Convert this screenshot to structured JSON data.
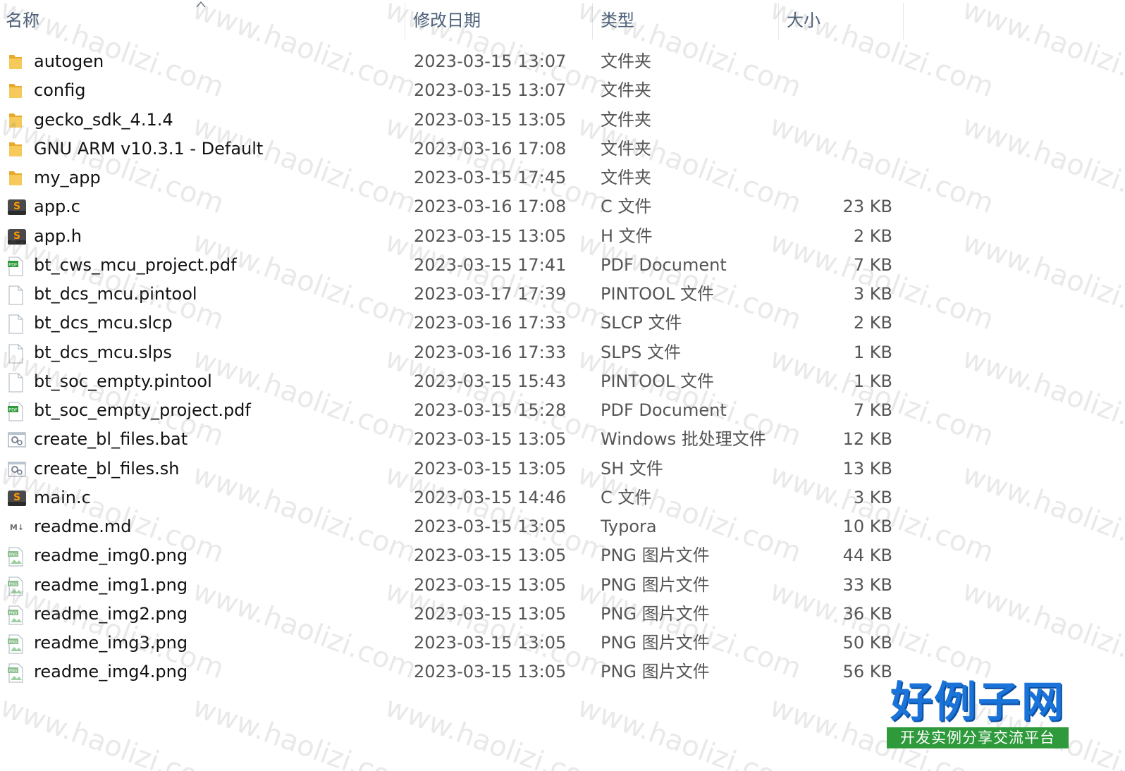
{
  "columns": {
    "name": "名称",
    "date": "修改日期",
    "type": "类型",
    "size": "大小"
  },
  "watermark": "www.haolizi.com",
  "files": [
    {
      "name": "autogen",
      "date": "2023-03-15 13:07",
      "type": "文件夹",
      "size": "",
      "icon": "folder-icon"
    },
    {
      "name": "config",
      "date": "2023-03-15 13:07",
      "type": "文件夹",
      "size": "",
      "icon": "folder-icon"
    },
    {
      "name": "gecko_sdk_4.1.4",
      "date": "2023-03-15 13:05",
      "type": "文件夹",
      "size": "",
      "icon": "folder-icon"
    },
    {
      "name": "GNU ARM v10.3.1 - Default",
      "date": "2023-03-16 17:08",
      "type": "文件夹",
      "size": "",
      "icon": "folder-icon"
    },
    {
      "name": "my_app",
      "date": "2023-03-15 17:45",
      "type": "文件夹",
      "size": "",
      "icon": "folder-icon"
    },
    {
      "name": "app.c",
      "date": "2023-03-16 17:08",
      "type": "C 文件",
      "size": "23 KB",
      "icon": "sublime-text-icon"
    },
    {
      "name": "app.h",
      "date": "2023-03-15 13:05",
      "type": "H 文件",
      "size": "2 KB",
      "icon": "sublime-text-icon"
    },
    {
      "name": "bt_cws_mcu_project.pdf",
      "date": "2023-03-15 17:41",
      "type": "PDF Document",
      "size": "7 KB",
      "icon": "pdf-file-icon"
    },
    {
      "name": "bt_dcs_mcu.pintool",
      "date": "2023-03-17 17:39",
      "type": "PINTOOL 文件",
      "size": "3 KB",
      "icon": "blank-file-icon"
    },
    {
      "name": "bt_dcs_mcu.slcp",
      "date": "2023-03-16 17:33",
      "type": "SLCP 文件",
      "size": "2 KB",
      "icon": "blank-file-icon"
    },
    {
      "name": "bt_dcs_mcu.slps",
      "date": "2023-03-16 17:33",
      "type": "SLPS 文件",
      "size": "1 KB",
      "icon": "blank-file-icon"
    },
    {
      "name": "bt_soc_empty.pintool",
      "date": "2023-03-15 15:43",
      "type": "PINTOOL 文件",
      "size": "1 KB",
      "icon": "blank-file-icon"
    },
    {
      "name": "bt_soc_empty_project.pdf",
      "date": "2023-03-15 15:28",
      "type": "PDF Document",
      "size": "7 KB",
      "icon": "pdf-file-icon"
    },
    {
      "name": "create_bl_files.bat",
      "date": "2023-03-15 13:05",
      "type": "Windows 批处理文件",
      "size": "12 KB",
      "icon": "batch-script-icon"
    },
    {
      "name": "create_bl_files.sh",
      "date": "2023-03-15 13:05",
      "type": "SH 文件",
      "size": "13 KB",
      "icon": "batch-script-icon"
    },
    {
      "name": "main.c",
      "date": "2023-03-15 14:46",
      "type": "C 文件",
      "size": "3 KB",
      "icon": "sublime-text-icon"
    },
    {
      "name": "readme.md",
      "date": "2023-03-15 13:05",
      "type": "Typora",
      "size": "10 KB",
      "icon": "markdown-file-icon"
    },
    {
      "name": "readme_img0.png",
      "date": "2023-03-15 13:05",
      "type": "PNG 图片文件",
      "size": "44 KB",
      "icon": "png-file-icon"
    },
    {
      "name": "readme_img1.png",
      "date": "2023-03-15 13:05",
      "type": "PNG 图片文件",
      "size": "33 KB",
      "icon": "png-file-icon"
    },
    {
      "name": "readme_img2.png",
      "date": "2023-03-15 13:05",
      "type": "PNG 图片文件",
      "size": "36 KB",
      "icon": "png-file-icon"
    },
    {
      "name": "readme_img3.png",
      "date": "2023-03-15 13:05",
      "type": "PNG 图片文件",
      "size": "50 KB",
      "icon": "png-file-icon"
    },
    {
      "name": "readme_img4.png",
      "date": "2023-03-15 13:05",
      "type": "PNG 图片文件",
      "size": "56 KB",
      "icon": "png-file-icon"
    }
  ],
  "logo": {
    "main": "好例子网",
    "sub": "开发实例分享交流平台"
  },
  "colors": {
    "header_text": "#4c607a",
    "folder": "#f3c24f",
    "logo_blue": "#1a73d8",
    "logo_green": "#2e9a3b"
  }
}
